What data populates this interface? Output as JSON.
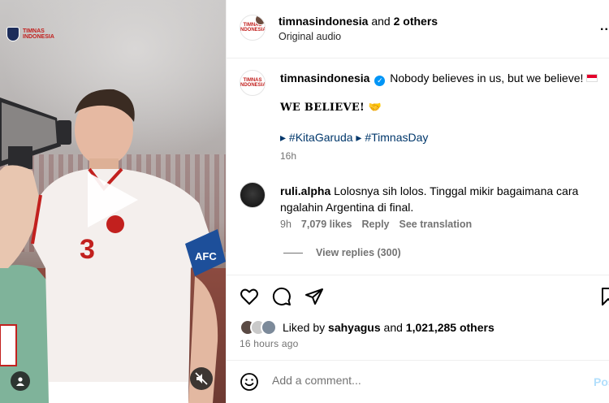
{
  "media": {
    "logo_text": "TIMNAS INDONESIA",
    "player_number": "3",
    "wristband_text": "AFC",
    "icons": {
      "play": "play-icon",
      "user": "user-tag-icon",
      "mute": "mute-icon"
    }
  },
  "header": {
    "username": "timnasindonesia",
    "and_text": " and ",
    "others": "2 others",
    "audio": "Original audio",
    "more": "..."
  },
  "caption": {
    "username": "timnasindonesia",
    "text": "Nobody believes in us, but we believe!",
    "line2": "WE BELIEVE! 🤝",
    "hashtag_prefix": "▸ ",
    "hashtag1": "#KitaGaruda",
    "hashtag_sep": " ▸ ",
    "hashtag2": "#TimnasDay",
    "time": "16h"
  },
  "comment": {
    "username": "ruli.alpha",
    "text": "Lolosnya sih lolos. Tinggal mikir bagaimana cara ngalahin Argentina di final.",
    "time": "9h",
    "likes": "7,079 likes",
    "reply": "Reply",
    "translate": "See translation",
    "view_replies": "View replies (300)"
  },
  "actions": {
    "icons": [
      "heart-icon",
      "comment-icon",
      "share-icon",
      "bookmark-icon"
    ]
  },
  "likes": {
    "prefix": "Liked by ",
    "user": "sahyagus",
    "middle": " and ",
    "count": "1,021,285 others"
  },
  "post_time": "16 hours ago",
  "comment_input": {
    "placeholder": "Add a comment...",
    "post_label": "Post"
  },
  "colors": {
    "accent": "#0095f6",
    "link": "#00376b",
    "muted": "#737373",
    "brand_red": "#c2201e"
  }
}
